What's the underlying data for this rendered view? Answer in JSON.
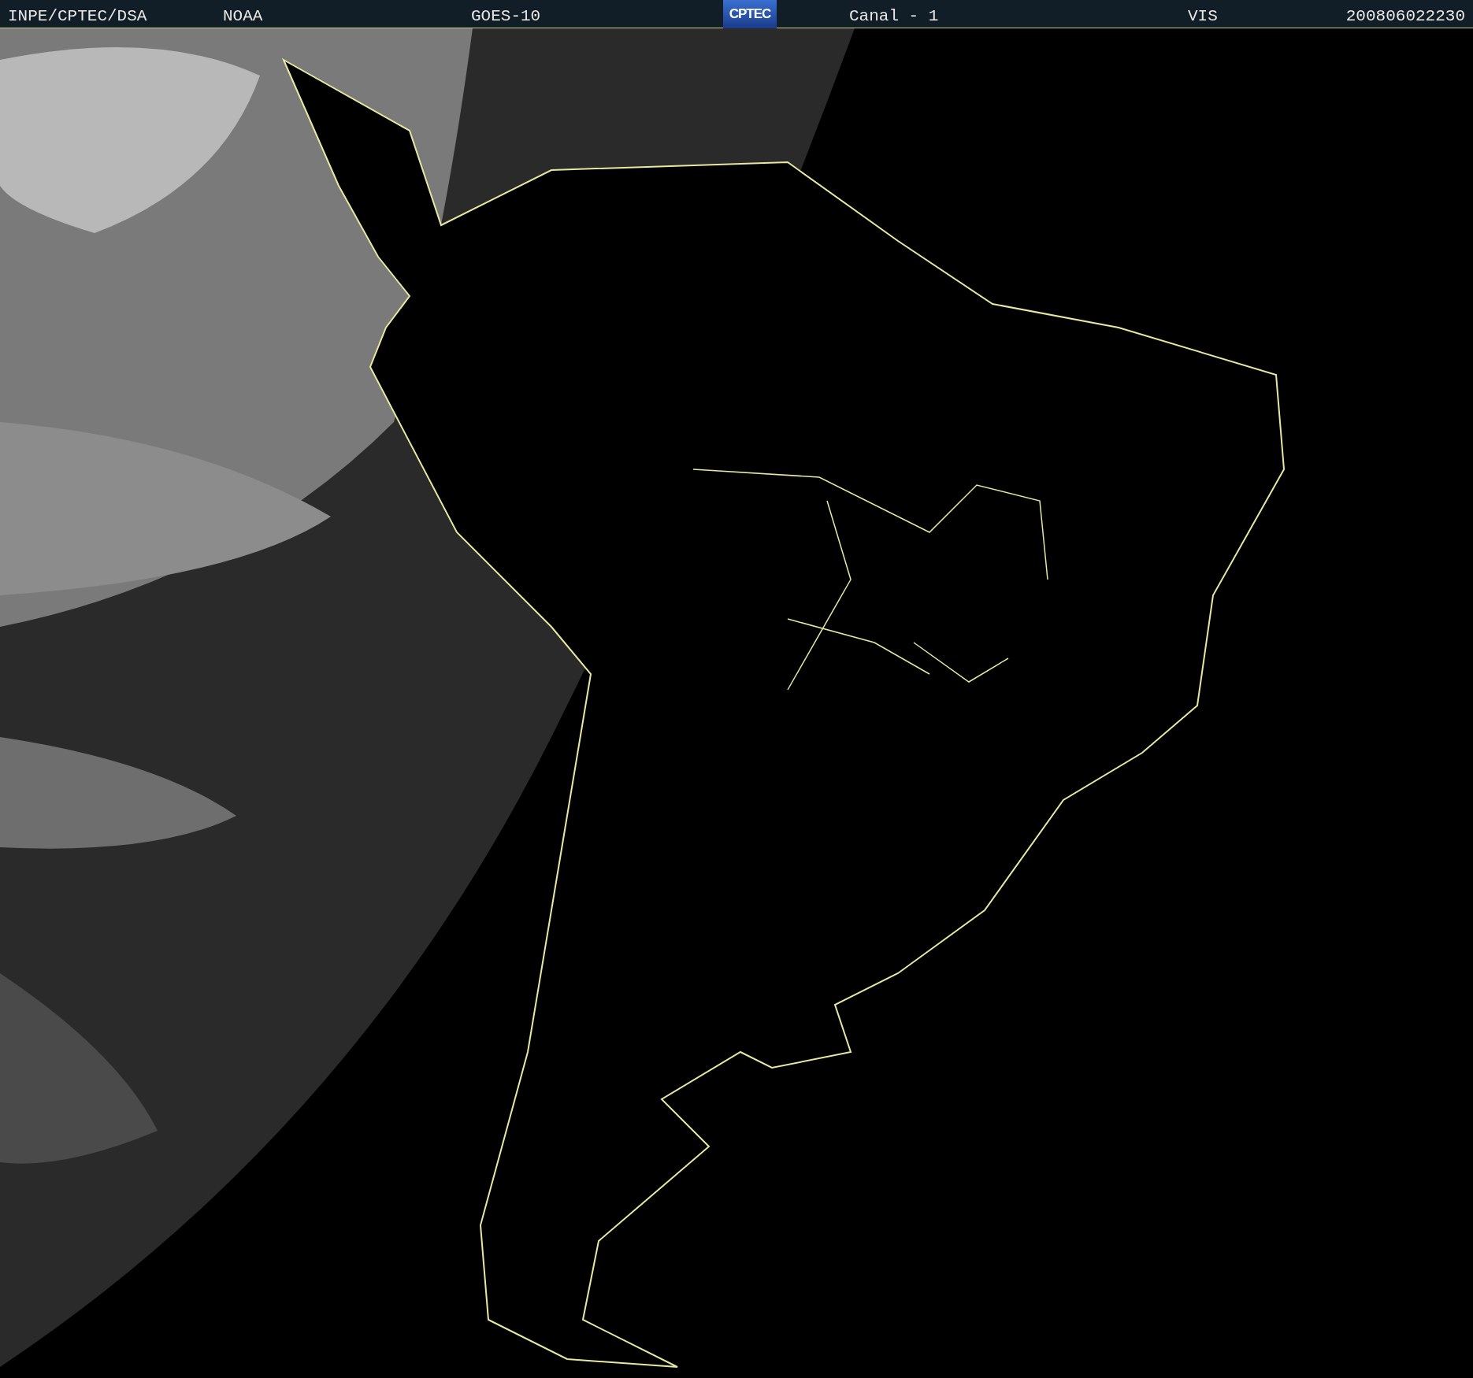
{
  "header": {
    "agency": "INPE/CPTEC/DSA",
    "operator": "NOAA",
    "satellite": "GOES-10",
    "logo": "CPTEC",
    "channel": "Canal - 1",
    "band": "VIS",
    "timestamp": "200806022230"
  }
}
